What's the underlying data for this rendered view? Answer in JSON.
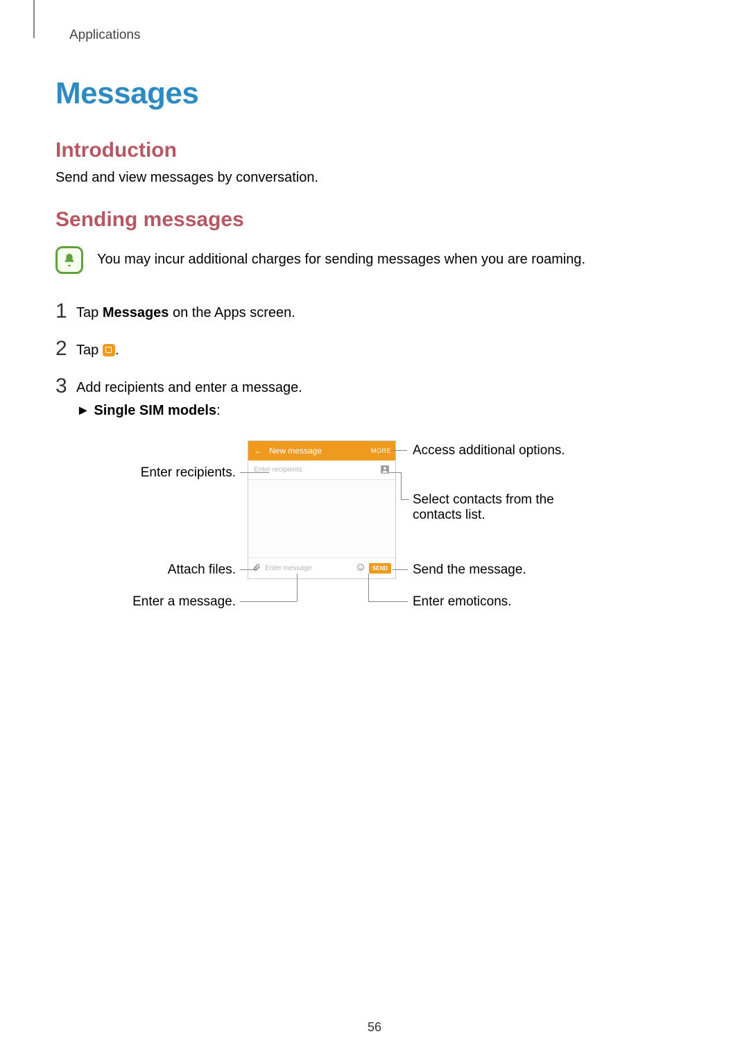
{
  "breadcrumb": "Applications",
  "h1": "Messages",
  "sections": {
    "intro_h": "Introduction",
    "intro_body": "Send and view messages by conversation.",
    "sending_h": "Sending messages"
  },
  "note": "You may incur additional charges for sending messages when you are roaming.",
  "steps": {
    "s1_pre": "Tap ",
    "s1_bold": "Messages",
    "s1_post": " on the Apps screen.",
    "s2_pre": "Tap ",
    "s2_post": ".",
    "s3": "Add recipients and enter a message.",
    "bullet_arrow": "►",
    "bullet_bold": "Single SIM models",
    "bullet_post": ":"
  },
  "phone": {
    "title": "New message",
    "more": "MORE",
    "recip_placeholder": "Enter recipients",
    "msg_placeholder": "Enter message",
    "send": "SEND"
  },
  "callouts": {
    "more": "Access additional options.",
    "recipients_left": "Enter recipients.",
    "contacts": "Select contacts from the contacts list.",
    "attach": "Attach files.",
    "enter_msg": "Enter a message.",
    "send": "Send the message.",
    "emoticons": "Enter emoticons."
  },
  "icons": {
    "bell": "bell-icon",
    "compose": "compose-icon",
    "back": "back-arrow-icon",
    "contact": "contact-icon",
    "attach": "paperclip-icon",
    "emoticon": "emoticon-icon"
  },
  "page_number": "56"
}
